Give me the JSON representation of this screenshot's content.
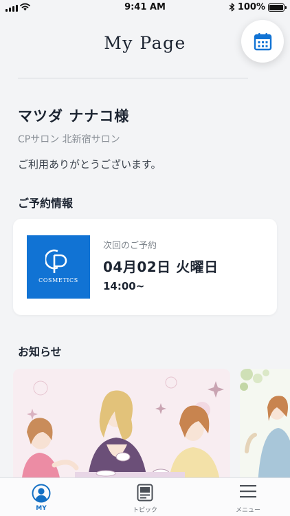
{
  "status_bar": {
    "time": "9:41 AM",
    "battery": "100%",
    "battery_level": 1.0
  },
  "header": {
    "title": "My Page"
  },
  "user": {
    "name": "マツダ ナナコ様",
    "salon": "CPサロン 北新宿サロン",
    "greeting": "ご利用ありがとうございます。"
  },
  "reservation": {
    "section_title": "ご予約情報",
    "brand_sub": "COSMETICS",
    "label": "次回のご予約",
    "date": "04月02日 火曜日",
    "time": "14:00~"
  },
  "news": {
    "section_title": "お知らせ"
  },
  "tabs": [
    {
      "label": "MY",
      "icon": "user-icon",
      "active": true
    },
    {
      "label": "トピック",
      "icon": "topic-icon",
      "active": false
    },
    {
      "label": "メニュー",
      "icon": "menu-icon",
      "active": false
    }
  ],
  "colors": {
    "accent": "#1173d4",
    "background": "#f3f4f6",
    "text": "#1c2431"
  }
}
